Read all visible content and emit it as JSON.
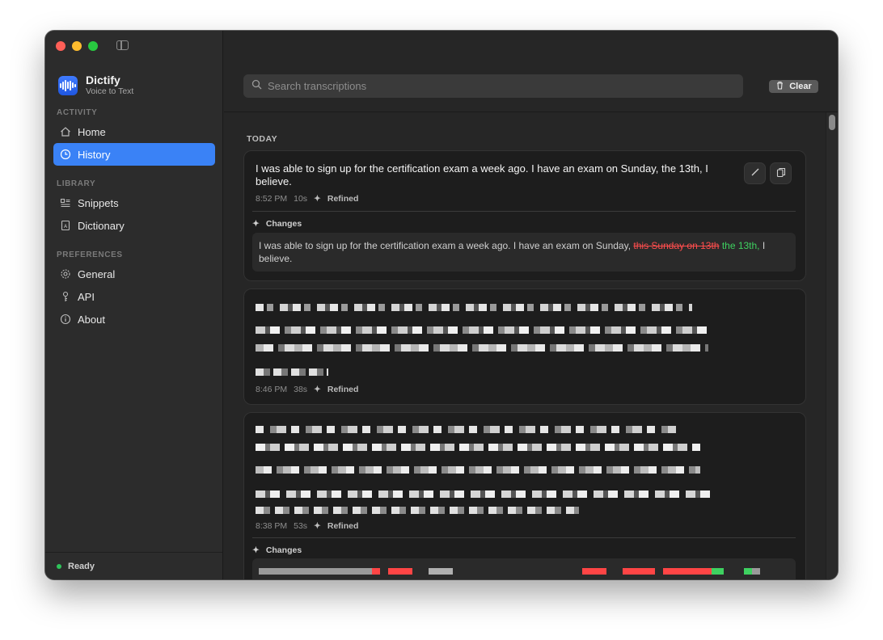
{
  "app": {
    "name": "Dictify",
    "subtitle": "Voice to Text"
  },
  "sidebar": {
    "sections": [
      {
        "label": "ACTIVITY",
        "items": [
          {
            "label": "Home",
            "icon": "house-icon"
          },
          {
            "label": "History",
            "icon": "clock-icon",
            "active": true
          }
        ]
      },
      {
        "label": "LIBRARY",
        "items": [
          {
            "label": "Snippets",
            "icon": "list-icon"
          },
          {
            "label": "Dictionary",
            "icon": "book-icon"
          }
        ]
      },
      {
        "label": "PREFERENCES",
        "items": [
          {
            "label": "General",
            "icon": "gear-icon"
          },
          {
            "label": "API",
            "icon": "key-icon"
          },
          {
            "label": "About",
            "icon": "info-icon"
          }
        ]
      }
    ],
    "status": "Ready"
  },
  "toolbar": {
    "search_placeholder": "Search transcriptions",
    "clear_label": "Clear"
  },
  "history": {
    "day_label": "TODAY",
    "entries": [
      {
        "text": "I was able to sign up for the certification exam a week ago. I have an exam on Sunday, the 13th, I believe.",
        "time": "8:52 PM",
        "duration": "10s",
        "status": "Refined",
        "changes_title": "Changes",
        "changes": {
          "prefix": "I was able to sign up for the certification exam a week ago. I have an exam on Sunday, ",
          "deleted": "this Sunday on 13th",
          "inserted": "the 13th,",
          "suffix": "I believe."
        }
      },
      {
        "text": "",
        "time": "8:46 PM",
        "duration": "38s",
        "status": "Refined"
      },
      {
        "text": "",
        "time": "8:38 PM",
        "duration": "53s",
        "status": "Refined",
        "changes_title": "Changes"
      }
    ]
  },
  "colors": {
    "accent": "#3a82f6",
    "deleted": "#ff4d4d",
    "inserted": "#3ed160",
    "status_ok": "#2ec45a"
  }
}
